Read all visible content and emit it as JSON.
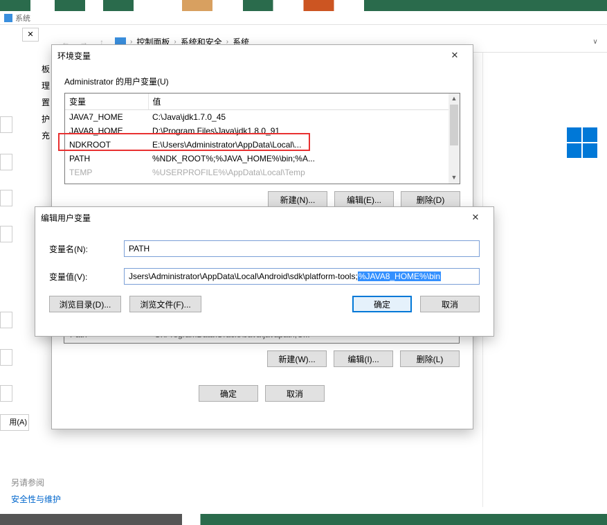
{
  "window": {
    "app_title": "系统"
  },
  "breadcrumb": {
    "item1": "控制面板",
    "item2": "系统和安全",
    "item3": "系统"
  },
  "sidebar_clip": [
    "板",
    "理",
    "置",
    "护",
    "充"
  ],
  "env_dialog": {
    "title": "环境变量",
    "user_vars_label": "Administrator 的用户变量(U)",
    "columns": {
      "var": "变量",
      "val": "值"
    },
    "rows": [
      {
        "name": "JAVA7_HOME",
        "value": "C:\\Java\\jdk1.7.0_45"
      },
      {
        "name": "JAVA8_HOME",
        "value": "D:\\Program Files\\Java\\jdk1.8.0_91"
      },
      {
        "name": "NDKROOT",
        "value": "E:\\Users\\Administrator\\AppData\\Local\\..."
      },
      {
        "name": "PATH",
        "value": "%NDK_ROOT%;%JAVA_HOME%\\bin;%A..."
      },
      {
        "name": "TEMP",
        "value": "%USERPROFILE%\\AppData\\Local\\Temp"
      }
    ],
    "btn_new": "新建(N)...",
    "btn_edit": "编辑(E)...",
    "btn_delete": "删除(D)",
    "btn_new_sys": "新建(W)...",
    "btn_edit_sys": "编辑(I)...",
    "btn_delete_sys": "删除(L)",
    "btn_ok": "确定",
    "btn_cancel": "取消",
    "sys_row": {
      "name": "Path",
      "value": "C:\\ProgramData\\Oracle\\Java\\javapath;C..."
    }
  },
  "edit_dialog": {
    "title": "编辑用户变量",
    "name_label": "变量名(N):",
    "value_label": "变量值(V):",
    "name_value": "PATH",
    "value_prefix": "Jsers\\Administrator\\AppData\\Local\\Android\\sdk\\platform-tools;",
    "value_selected": "%JAVA8_HOME%\\bin",
    "btn_browse_dir": "浏览目录(D)...",
    "btn_browse_file": "浏览文件(F)...",
    "btn_ok": "确定",
    "btn_cancel": "取消"
  },
  "bottom_left": {
    "text1": "另请参阅",
    "link1": "安全性与维护",
    "btn": "用(A)"
  }
}
